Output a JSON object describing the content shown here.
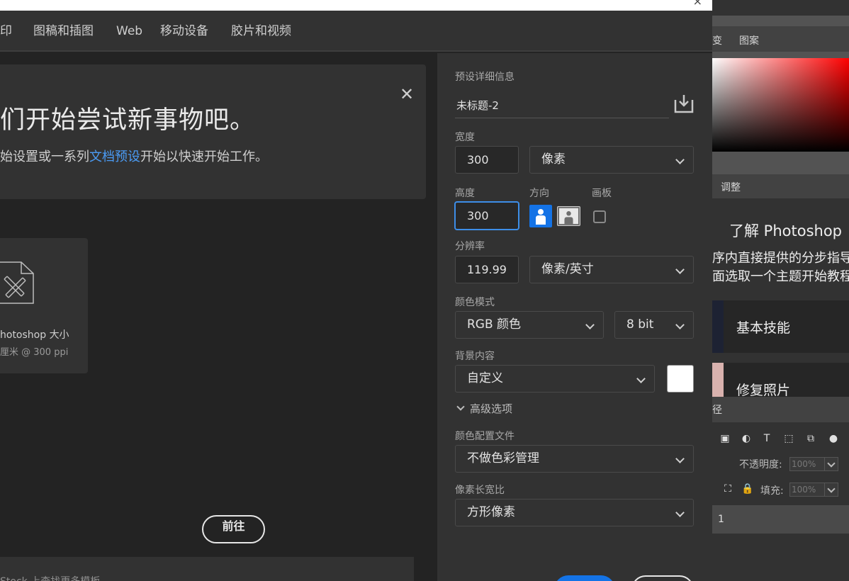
{
  "tabs": [
    "印",
    "图稿和插图",
    "Web",
    "移动设备",
    "胶片和视频"
  ],
  "banner": {
    "title": "们开始尝试新事物吧。",
    "sub_before": "始设置或一系列",
    "sub_link": "文档预设",
    "sub_after": "开始以快速开始工作。"
  },
  "tile": {
    "name": "hotoshop 大小",
    "size": "厘米 @ 300 ppi"
  },
  "footer": {
    "text": "Stock 上查找更多模板",
    "button": "前往"
  },
  "details": {
    "section_label": "预设详细信息",
    "name": "未标题-2",
    "width_label": "宽度",
    "width_value": "300",
    "width_unit": "像素",
    "height_label": "高度",
    "height_value": "300",
    "orientation_label": "方向",
    "artboard_label": "画板",
    "resolution_label": "分辨率",
    "resolution_value": "119.99",
    "resolution_unit": "像素/英寸",
    "color_mode_label": "颜色模式",
    "color_mode": "RGB 颜色",
    "bit_depth": "8 bit",
    "background_label": "背景内容",
    "background": "自定义",
    "background_color": "#ffffff",
    "advanced_label": "高级选项",
    "color_profile_label": "颜色配置文件",
    "color_profile": "不做色彩管理",
    "pixel_aspect_label": "像素长宽比",
    "pixel_aspect": "方形像素"
  },
  "ps_panels": {
    "tab_gradient_partial": "变",
    "tab_patterns": "图案",
    "tab_adjustments": "调整",
    "learn_title": "了解 Photoshop",
    "learn_line1": "序内直接提供的分步指导",
    "learn_line2": "面选取一个主题开始教程",
    "card1": "基本技能",
    "card2": "修复照片",
    "paths_partial": "径",
    "opacity_label": "不透明度:",
    "opacity_value": "100%",
    "fill_label": "填充:",
    "fill_value": "100%",
    "layer_name": "1"
  },
  "colors": {
    "accent": "#1473e6",
    "link": "#4b9cf5"
  }
}
